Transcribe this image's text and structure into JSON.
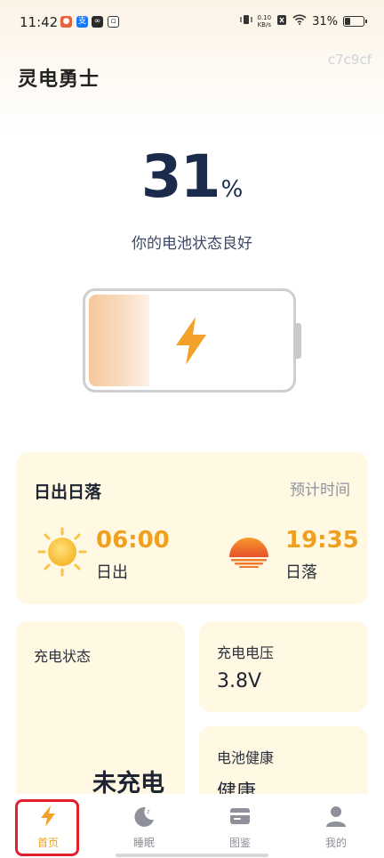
{
  "status_bar": {
    "time": "11:42",
    "speed_value": "0.10",
    "speed_unit": "KB/s",
    "battery": "31%"
  },
  "app": {
    "title": "灵电勇士",
    "hex_code": "c7c9cf"
  },
  "battery": {
    "level_number": "31",
    "level_unit": "%",
    "level_fraction": 0.31,
    "health_text": "你的电池状态良好"
  },
  "sun_card": {
    "title": "日出日落",
    "link": "预计时间",
    "sunrise_time": "06:00",
    "sunrise_label": "日出",
    "sunset_time": "19:35",
    "sunset_label": "日落"
  },
  "charge_card": {
    "label": "充电状态",
    "status": "未充电"
  },
  "voltage_card": {
    "label": "充电电压",
    "value": "3.8V"
  },
  "health_card": {
    "label": "电池健康",
    "value": "健康"
  },
  "tabs": [
    {
      "label": "首页",
      "icon": "bolt-icon",
      "active": true
    },
    {
      "label": "睡眠",
      "icon": "moon-icon",
      "active": false
    },
    {
      "label": "图鉴",
      "icon": "card-icon",
      "active": false
    },
    {
      "label": "我的",
      "icon": "person-icon",
      "active": false
    }
  ],
  "colors": {
    "accent": "#f0a020",
    "card_bg": "#fff8e3",
    "percent_text": "#1b2b4b",
    "highlight": "#e1212b"
  }
}
